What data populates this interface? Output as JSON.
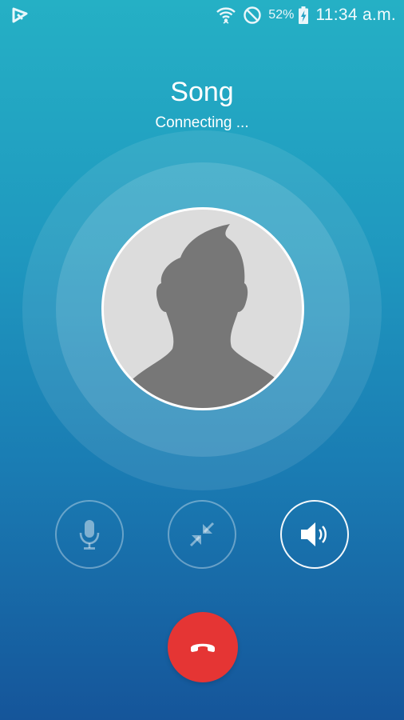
{
  "status_bar": {
    "battery_percent": "52%",
    "time": "11:34 a.m.",
    "icons": [
      "app-notification-icon",
      "wifi-icon",
      "do-not-disturb-icon",
      "battery-charging-icon"
    ]
  },
  "call": {
    "caller_name": "Song",
    "status": "Connecting ..."
  },
  "controls": {
    "mute": {
      "icon": "microphone-icon",
      "state": "inactive"
    },
    "minimize": {
      "icon": "minimize-icon",
      "state": "inactive"
    },
    "speaker": {
      "icon": "speaker-icon",
      "state": "active"
    },
    "end_call": {
      "icon": "hang-up-icon",
      "color": "#e53534"
    }
  },
  "colors": {
    "background_top": "#25b0c5",
    "background_bottom": "#15559a",
    "avatar_silhouette": "#777777",
    "avatar_background": "#dcdcdc"
  }
}
